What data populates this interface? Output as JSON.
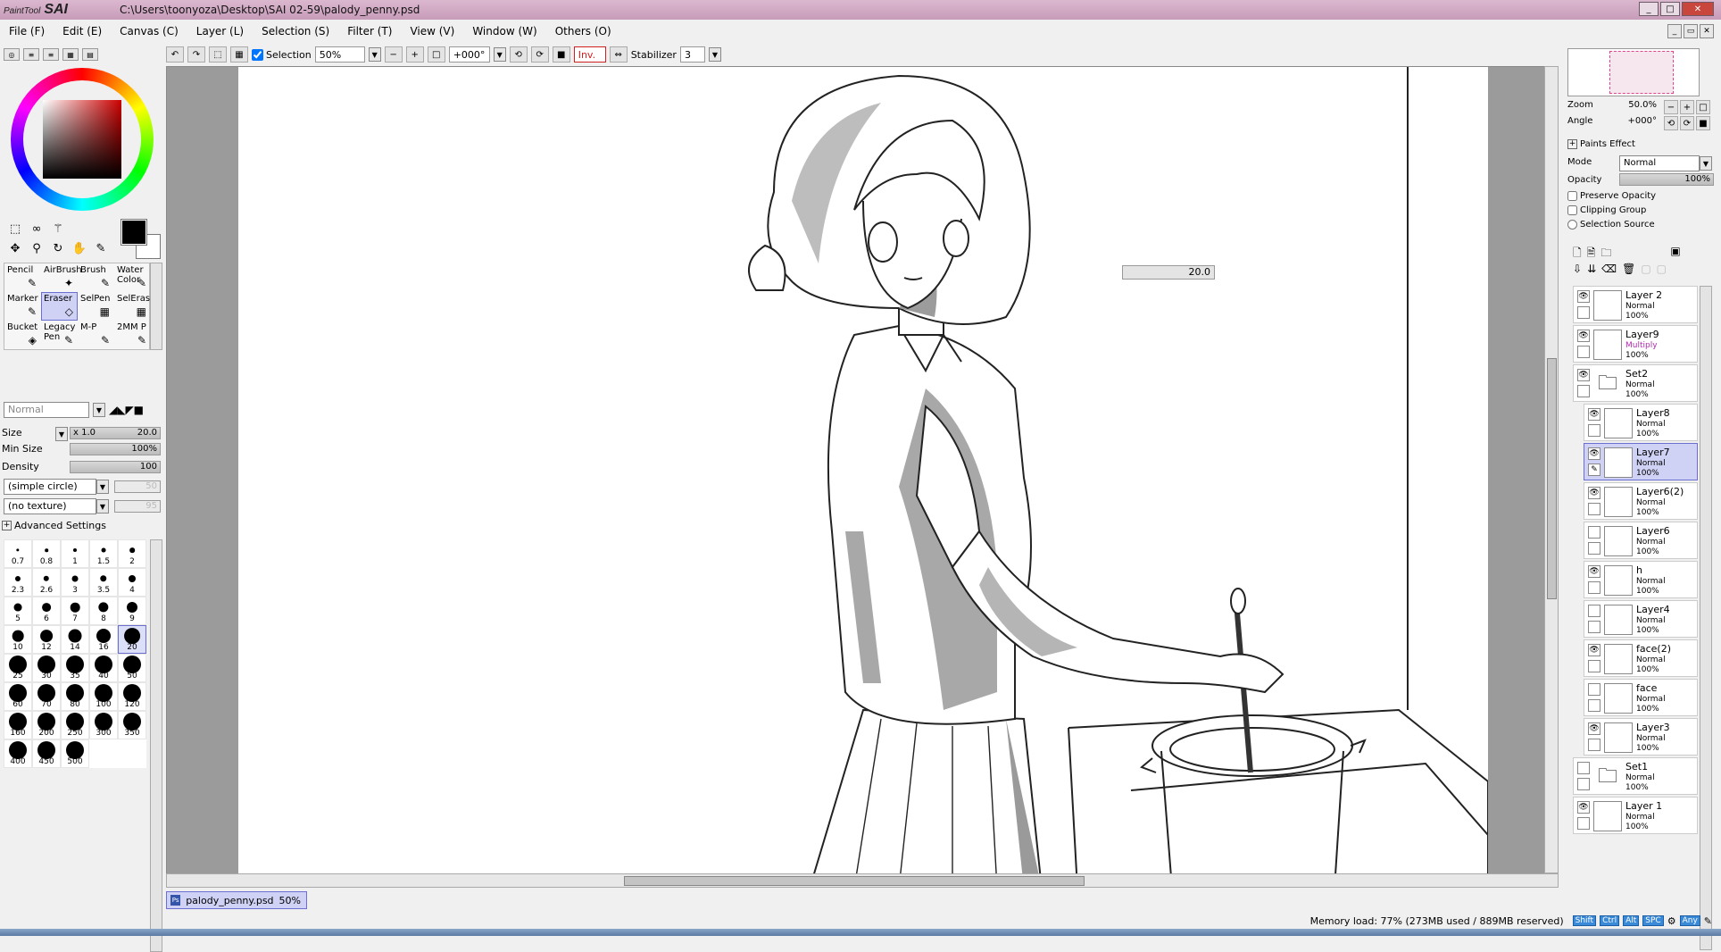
{
  "titlebar": {
    "app": "SAI",
    "app_small": "PaintTool",
    "path": "C:\\Users\\toonyoza\\Desktop\\SAI 02-59\\palody_penny.psd"
  },
  "window_buttons": [
    "_",
    "□",
    "✕"
  ],
  "menu": [
    "File (F)",
    "Edit (E)",
    "Canvas (C)",
    "Layer (L)",
    "Selection (S)",
    "Filter (T)",
    "View (V)",
    "Window (W)",
    "Others (O)"
  ],
  "toolbar": {
    "selection_label": "Selection",
    "zoom": "50%",
    "angle": "+000°",
    "invert": "Inv.",
    "stabilizer_label": "Stabilizer",
    "stabilizer": "3"
  },
  "brushes": [
    {
      "name": "Pencil",
      "sel": false
    },
    {
      "name": "AirBrush",
      "sel": false
    },
    {
      "name": "Brush",
      "sel": false
    },
    {
      "name": "Water Color",
      "sel": false
    },
    {
      "name": "Marker",
      "sel": false
    },
    {
      "name": "Eraser",
      "sel": true
    },
    {
      "name": "SelPen",
      "sel": false
    },
    {
      "name": "SelEras",
      "sel": false
    },
    {
      "name": "Bucket",
      "sel": false
    },
    {
      "name": "Legacy Pen",
      "sel": false
    },
    {
      "name": "M-P",
      "sel": false
    },
    {
      "name": "2MM P",
      "sel": false
    }
  ],
  "brush_props": {
    "blend_mode": "Normal",
    "size_label": "Size",
    "size_mult": "x 1.0",
    "size": "20.0",
    "min_size_label": "Min Size",
    "min_size": "100%",
    "density_label": "Density",
    "density": "100",
    "shape": "(simple circle)",
    "shape_val": "50",
    "texture": "(no texture)",
    "texture_val": "95",
    "advanced": "Advanced Settings"
  },
  "brush_sizes": [
    "0.7",
    "0.8",
    "1",
    "1.5",
    "2",
    "2.3",
    "2.6",
    "3",
    "3.5",
    "4",
    "5",
    "6",
    "7",
    "8",
    "9",
    "10",
    "12",
    "14",
    "16",
    "20",
    "25",
    "30",
    "35",
    "40",
    "50",
    "60",
    "70",
    "80",
    "100",
    "120",
    "160",
    "200",
    "250",
    "300",
    "350",
    "400",
    "450",
    "500"
  ],
  "selected_brush_size": "20",
  "canvas_tooltip": "20.0",
  "document_tab": {
    "name": "palody_penny.psd",
    "zoom": "50%"
  },
  "navigator": {
    "zoom_label": "Zoom",
    "zoom": "50.0%",
    "angle_label": "Angle",
    "angle": "+000°"
  },
  "layer_props": {
    "paints_effect": "Paints Effect",
    "mode_label": "Mode",
    "mode": "Normal",
    "opacity_label": "Opacity",
    "opacity": "100%",
    "preserve": "Preserve Opacity",
    "clipping": "Clipping Group",
    "selsource": "Selection Source"
  },
  "layers": [
    {
      "name": "Layer 2",
      "mode": "Normal",
      "opacity": "100%",
      "visible": true,
      "indent": 0,
      "folder": false,
      "sel": false
    },
    {
      "name": "Layer9",
      "mode": "Multiply",
      "opacity": "100%",
      "visible": true,
      "indent": 0,
      "folder": false,
      "sel": false
    },
    {
      "name": "Set2",
      "mode": "Normal",
      "opacity": "100%",
      "visible": true,
      "indent": 0,
      "folder": true,
      "sel": false
    },
    {
      "name": "Layer8",
      "mode": "Normal",
      "opacity": "100%",
      "visible": true,
      "indent": 1,
      "folder": false,
      "sel": false
    },
    {
      "name": "Layer7",
      "mode": "Normal",
      "opacity": "100%",
      "visible": true,
      "indent": 1,
      "folder": false,
      "sel": true
    },
    {
      "name": "Layer6(2)",
      "mode": "Normal",
      "opacity": "100%",
      "visible": true,
      "indent": 1,
      "folder": false,
      "sel": false
    },
    {
      "name": "Layer6",
      "mode": "Normal",
      "opacity": "100%",
      "visible": false,
      "indent": 1,
      "folder": false,
      "sel": false
    },
    {
      "name": "h",
      "mode": "Normal",
      "opacity": "100%",
      "visible": true,
      "indent": 1,
      "folder": false,
      "sel": false
    },
    {
      "name": "Layer4",
      "mode": "Normal",
      "opacity": "100%",
      "visible": false,
      "indent": 1,
      "folder": false,
      "sel": false
    },
    {
      "name": "face(2)",
      "mode": "Normal",
      "opacity": "100%",
      "visible": true,
      "indent": 1,
      "folder": false,
      "sel": false
    },
    {
      "name": "face",
      "mode": "Normal",
      "opacity": "100%",
      "visible": false,
      "indent": 1,
      "folder": false,
      "sel": false
    },
    {
      "name": "Layer3",
      "mode": "Normal",
      "opacity": "100%",
      "visible": true,
      "indent": 1,
      "folder": false,
      "sel": false
    },
    {
      "name": "Set1",
      "mode": "Normal",
      "opacity": "100%",
      "visible": false,
      "indent": 0,
      "folder": true,
      "sel": false
    },
    {
      "name": "Layer 1",
      "mode": "Normal",
      "opacity": "100%",
      "visible": true,
      "indent": 0,
      "folder": false,
      "sel": false
    }
  ],
  "status": {
    "memory": "Memory load: 77% (273MB used / 889MB reserved)",
    "keys": [
      "Shift",
      "Ctrl",
      "Alt",
      "SPC",
      "Any"
    ]
  }
}
